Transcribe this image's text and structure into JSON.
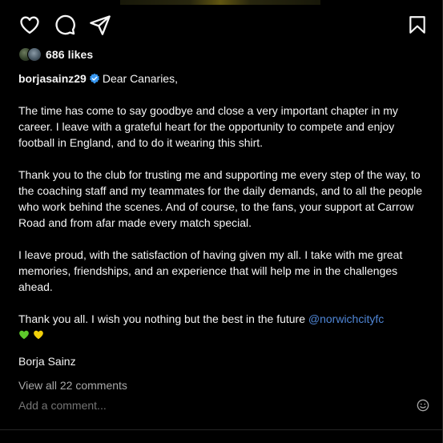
{
  "post": {
    "likes": "686 likes",
    "username": "borjasainz29",
    "greeting": "Dear Canaries,",
    "paragraph1": "The time has come to say goodbye and close a very important chapter in my career. I leave with a grateful heart for the opportunity to compete and enjoy football in England, and to do it wearing this shirt.",
    "paragraph2": "Thank you to the club for trusting me and supporting me every step of the way, to the coaching staff and my teammates for the daily demands, and to all the people who work behind the scenes. And of course, to the fans, your support at Carrow Road and from afar made every match special.",
    "paragraph3": "I leave proud, with the satisfaction of having given my all. I take with me great memories, friendships, and an experience that will help me in the challenges ahead.",
    "paragraph4": "Thank you all. I wish you nothing but the best in the future",
    "mention": "@norwichcityfc",
    "signature": "Borja Sainz",
    "view_comments": "View all 22 comments",
    "add_comment_placeholder": "Add a comment..."
  },
  "icons": {
    "like": "heart-icon",
    "comment": "comment-bubble-icon",
    "share": "paper-plane-icon",
    "save": "bookmark-icon",
    "verified": "verified-badge-icon",
    "emoji": "smiley-icon",
    "green_heart": "green-heart-emoji",
    "yellow_heart": "yellow-heart-emoji"
  },
  "colors": {
    "background": "#000000",
    "text": "#f5f5f5",
    "muted": "#a8a8a8",
    "link": "#4f86d6",
    "verified": "#3897f0",
    "green_heart": "#5ec92b",
    "yellow_heart": "#f2d00a"
  }
}
